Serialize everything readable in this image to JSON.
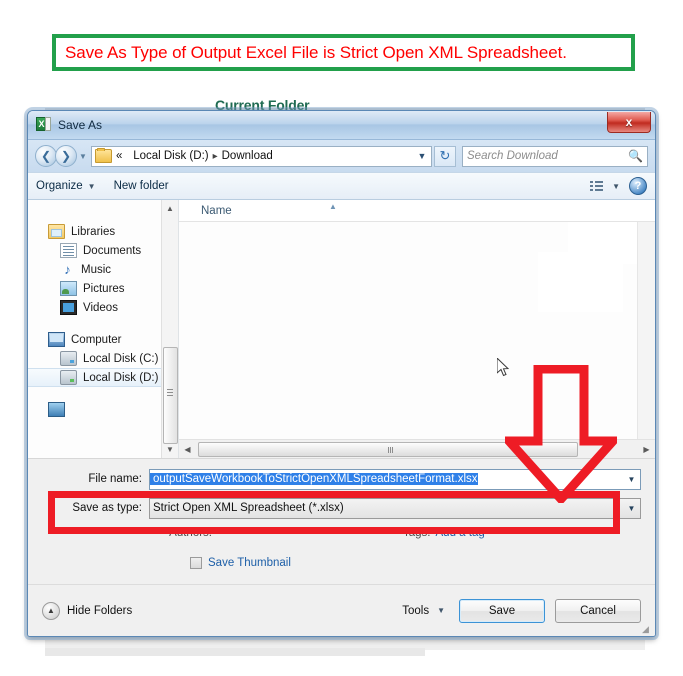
{
  "annotation": {
    "banner_text": "Save As Type of Output Excel File is Strict Open XML Spreadsheet.",
    "banner_border_color": "#22a04b",
    "banner_text_color": "#ff0000",
    "highlight_color": "#ee1c25",
    "arrow_direction": "down"
  },
  "background": {
    "label": "Current Folder"
  },
  "dialog": {
    "title": "Save As",
    "title_icon": "excel-icon",
    "close_label": "x",
    "addressbar": {
      "back_icon": "back-arrow-icon",
      "forward_icon": "forward-arrow-icon",
      "history_icon": "chevron-down-icon",
      "folder_icon": "folder-icon",
      "overflow": "«",
      "crumb1": "Local Disk (D:)",
      "crumb_sep": "▸",
      "crumb2": "Download",
      "dropdown_icon": "chevron-down-icon",
      "refresh_icon": "refresh-icon",
      "search_placeholder": "Search Download",
      "search_value": "",
      "search_icon": "search-icon"
    },
    "commandbar": {
      "organize": "Organize",
      "new_folder": "New folder",
      "view_icon": "view-list-icon",
      "view_caret": "chevron-down-icon",
      "help_icon": "help-icon",
      "help_label": "?"
    },
    "navpane": {
      "items": [
        {
          "label": "Libraries",
          "icon": "libraries-icon",
          "level": 0,
          "selected": false
        },
        {
          "label": "Documents",
          "icon": "documents-icon",
          "level": 1,
          "selected": false
        },
        {
          "label": "Music",
          "icon": "music-icon",
          "level": 1,
          "selected": false
        },
        {
          "label": "Pictures",
          "icon": "pictures-icon",
          "level": 1,
          "selected": false
        },
        {
          "label": "Videos",
          "icon": "videos-icon",
          "level": 1,
          "selected": false
        },
        {
          "label": "Computer",
          "icon": "computer-icon",
          "level": 0,
          "selected": false
        },
        {
          "label": "Local Disk (C:)",
          "icon": "disk-icon",
          "level": 1,
          "selected": false
        },
        {
          "label": "Local Disk (D:)",
          "icon": "disk-icon",
          "level": 1,
          "selected": true
        }
      ],
      "scroll_up_icon": "chevron-up-icon",
      "scroll_down_icon": "chevron-down-icon"
    },
    "filelist": {
      "column_header": "Name",
      "sort_icon": "sort-ascending-icon",
      "rows": [],
      "hscroll_left_icon": "chevron-left-icon",
      "hscroll_right_icon": "chevron-right-icon"
    },
    "form": {
      "filename_label": "File name:",
      "filename_value": "outputSaveWorkbookToStrictOpenXMLSpreadsheetFormat.xlsx",
      "filename_dropdown_icon": "chevron-down-icon",
      "savetype_label": "Save as type:",
      "savetype_value": "Strict Open XML Spreadsheet (*.xlsx)",
      "savetype_dropdown_icon": "chevron-down-icon",
      "authors_label": "Authors:",
      "authors_value": "",
      "tags_label": "Tags:",
      "tags_link": "Add a tag",
      "thumbnail_label": "Save Thumbnail",
      "thumbnail_checked": false
    },
    "footer": {
      "hide_folders": "Hide Folders",
      "hide_folders_icon": "collapse-icon",
      "tools_label": "Tools",
      "tools_caret": "chevron-down-icon",
      "save_label": "Save",
      "cancel_label": "Cancel"
    }
  }
}
